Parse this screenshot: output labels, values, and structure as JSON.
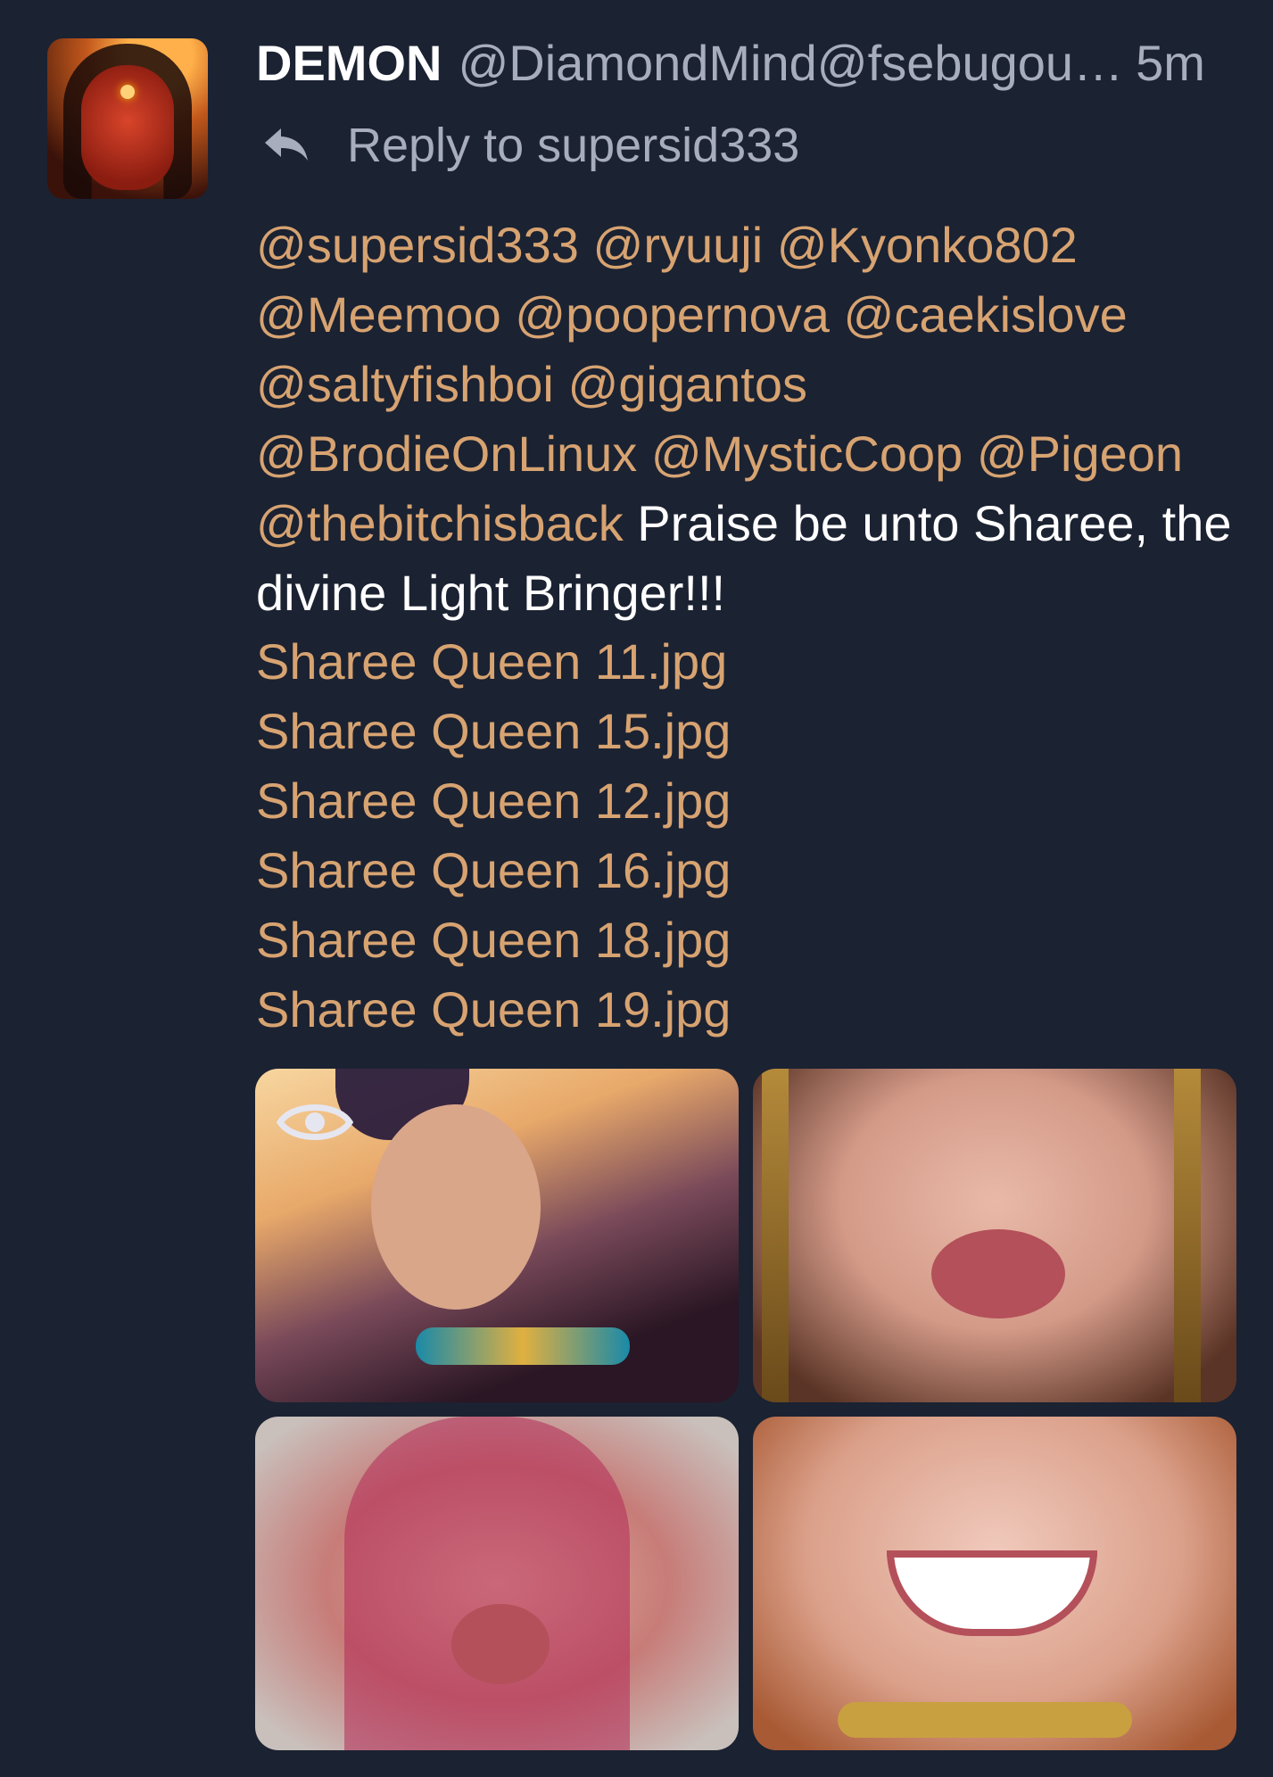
{
  "post": {
    "display_name": "DEMON",
    "handle": "@DiamondMind@fsebugou…",
    "time": "5m",
    "reply_to": "Reply to supersid333",
    "mentions": [
      "@supersid333",
      "@ryuuji",
      "@Kyonko802",
      "@Meemoo",
      "@poopernova",
      "@caekislove",
      "@saltyfishboi",
      "@gigantos",
      "@BrodieOnLinux",
      "@MysticCoop",
      "@Pigeon",
      "@thebitchisback"
    ],
    "text": "Praise be unto Sharee, the divine Light Bringer!!!",
    "attachments": [
      "Sharee Queen 11.jpg",
      "Sharee Queen 15.jpg",
      "Sharee Queen 12.jpg",
      "Sharee Queen 16.jpg",
      "Sharee Queen 18.jpg",
      "Sharee Queen 19.jpg"
    ]
  },
  "colors": {
    "background": "#1b2232",
    "mention": "#d7a371",
    "text": "#ffffff",
    "muted": "#a7adbd"
  },
  "icons": {
    "reply": "reply-arrow-icon",
    "sensitive_media": "eye-icon"
  }
}
